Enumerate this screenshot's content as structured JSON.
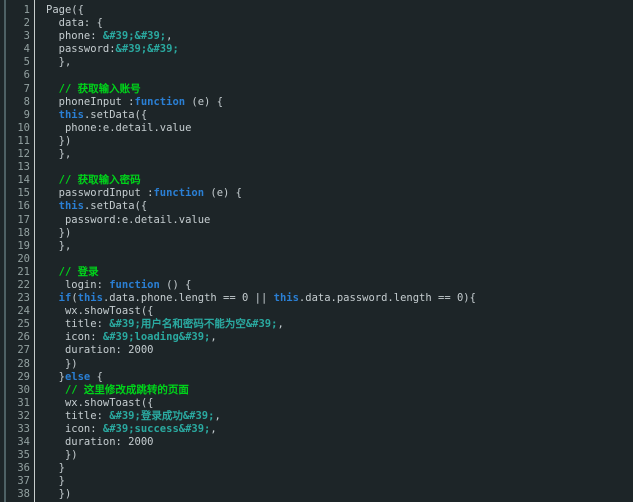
{
  "editor": {
    "theme_name": "dark-code-viewer",
    "background_color": "#1d2528",
    "gutter_text_color": "#93a1a1",
    "code_text_color": "#c5cdd0",
    "comment_color": "#00d21a",
    "keyword_color": "#2a7fd4",
    "string_color": "#2aa9a0",
    "separator_color": "#c7cdcd",
    "rail_color": "#4e6165",
    "first_line_number": 1,
    "last_line_number": 38,
    "total_lines": 38,
    "language": "javascript"
  },
  "lines": [
    {
      "num": "1",
      "tokens": [
        {
          "t": "Page({",
          "c": "plain"
        }
      ]
    },
    {
      "num": "2",
      "tokens": [
        {
          "t": "  data: {",
          "c": "plain"
        }
      ]
    },
    {
      "num": "3",
      "tokens": [
        {
          "t": "  phone: ",
          "c": "plain"
        },
        {
          "t": "&#39;&#39;",
          "c": "string"
        },
        {
          "t": ",",
          "c": "plain"
        }
      ]
    },
    {
      "num": "4",
      "tokens": [
        {
          "t": "  password:",
          "c": "plain"
        },
        {
          "t": "&#39;&#39;",
          "c": "string"
        }
      ]
    },
    {
      "num": "5",
      "tokens": [
        {
          "t": "  },",
          "c": "plain"
        }
      ]
    },
    {
      "num": "6",
      "tokens": [
        {
          "t": "",
          "c": "plain"
        }
      ]
    },
    {
      "num": "7",
      "tokens": [
        {
          "t": "  // 获取输入账号",
          "c": "comment"
        }
      ]
    },
    {
      "num": "8",
      "tokens": [
        {
          "t": "  phoneInput :",
          "c": "plain"
        },
        {
          "t": "function",
          "c": "keyword"
        },
        {
          "t": " (e) {",
          "c": "plain"
        }
      ]
    },
    {
      "num": "9",
      "tokens": [
        {
          "t": "  ",
          "c": "plain"
        },
        {
          "t": "this",
          "c": "keyword"
        },
        {
          "t": ".setData({",
          "c": "plain"
        }
      ]
    },
    {
      "num": "10",
      "tokens": [
        {
          "t": "   phone:e.detail.value",
          "c": "plain"
        }
      ]
    },
    {
      "num": "11",
      "tokens": [
        {
          "t": "  })",
          "c": "plain"
        }
      ]
    },
    {
      "num": "12",
      "tokens": [
        {
          "t": "  },",
          "c": "plain"
        }
      ]
    },
    {
      "num": "13",
      "tokens": [
        {
          "t": "",
          "c": "plain"
        }
      ]
    },
    {
      "num": "14",
      "tokens": [
        {
          "t": "  // 获取输入密码",
          "c": "comment"
        }
      ]
    },
    {
      "num": "15",
      "tokens": [
        {
          "t": "  passwordInput :",
          "c": "plain"
        },
        {
          "t": "function",
          "c": "keyword"
        },
        {
          "t": " (e) {",
          "c": "plain"
        }
      ]
    },
    {
      "num": "16",
      "tokens": [
        {
          "t": "  ",
          "c": "plain"
        },
        {
          "t": "this",
          "c": "keyword"
        },
        {
          "t": ".setData({",
          "c": "plain"
        }
      ]
    },
    {
      "num": "17",
      "tokens": [
        {
          "t": "   password:e.detail.value",
          "c": "plain"
        }
      ]
    },
    {
      "num": "18",
      "tokens": [
        {
          "t": "  })",
          "c": "plain"
        }
      ]
    },
    {
      "num": "19",
      "tokens": [
        {
          "t": "  },",
          "c": "plain"
        }
      ]
    },
    {
      "num": "20",
      "tokens": [
        {
          "t": "",
          "c": "plain"
        }
      ]
    },
    {
      "num": "21",
      "tokens": [
        {
          "t": "  // 登录",
          "c": "comment"
        }
      ]
    },
    {
      "num": "22",
      "tokens": [
        {
          "t": "   login: ",
          "c": "plain"
        },
        {
          "t": "function",
          "c": "keyword"
        },
        {
          "t": " () {",
          "c": "plain"
        }
      ]
    },
    {
      "num": "23",
      "tokens": [
        {
          "t": "  ",
          "c": "plain"
        },
        {
          "t": "if",
          "c": "keyword"
        },
        {
          "t": "(",
          "c": "plain"
        },
        {
          "t": "this",
          "c": "keyword"
        },
        {
          "t": ".data.phone.length == 0 || ",
          "c": "plain"
        },
        {
          "t": "this",
          "c": "keyword"
        },
        {
          "t": ".data.password.length == 0){",
          "c": "plain"
        }
      ]
    },
    {
      "num": "24",
      "tokens": [
        {
          "t": "   wx.showToast({",
          "c": "plain"
        }
      ]
    },
    {
      "num": "25",
      "tokens": [
        {
          "t": "   title: ",
          "c": "plain"
        },
        {
          "t": "&#39;用户名和密码不能为空&#39;",
          "c": "string"
        },
        {
          "t": ",",
          "c": "plain"
        }
      ]
    },
    {
      "num": "26",
      "tokens": [
        {
          "t": "   icon: ",
          "c": "plain"
        },
        {
          "t": "&#39;loading&#39;",
          "c": "string"
        },
        {
          "t": ",",
          "c": "plain"
        }
      ]
    },
    {
      "num": "27",
      "tokens": [
        {
          "t": "   duration: 2000",
          "c": "plain"
        }
      ]
    },
    {
      "num": "28",
      "tokens": [
        {
          "t": "   })",
          "c": "plain"
        }
      ]
    },
    {
      "num": "29",
      "tokens": [
        {
          "t": "  }",
          "c": "plain"
        },
        {
          "t": "else",
          "c": "keyword"
        },
        {
          "t": " {",
          "c": "plain"
        }
      ]
    },
    {
      "num": "30",
      "tokens": [
        {
          "t": "   // 这里修改成跳转的页面",
          "c": "comment"
        }
      ]
    },
    {
      "num": "31",
      "tokens": [
        {
          "t": "   wx.showToast({",
          "c": "plain"
        }
      ]
    },
    {
      "num": "32",
      "tokens": [
        {
          "t": "   title: ",
          "c": "plain"
        },
        {
          "t": "&#39;登录成功&#39;",
          "c": "string"
        },
        {
          "t": ",",
          "c": "plain"
        }
      ]
    },
    {
      "num": "33",
      "tokens": [
        {
          "t": "   icon: ",
          "c": "plain"
        },
        {
          "t": "&#39;success&#39;",
          "c": "string"
        },
        {
          "t": ",",
          "c": "plain"
        }
      ]
    },
    {
      "num": "34",
      "tokens": [
        {
          "t": "   duration: 2000",
          "c": "plain"
        }
      ]
    },
    {
      "num": "35",
      "tokens": [
        {
          "t": "   })",
          "c": "plain"
        }
      ]
    },
    {
      "num": "36",
      "tokens": [
        {
          "t": "  }",
          "c": "plain"
        }
      ]
    },
    {
      "num": "37",
      "tokens": [
        {
          "t": "  }",
          "c": "plain"
        }
      ]
    },
    {
      "num": "38",
      "tokens": [
        {
          "t": "  })",
          "c": "plain"
        }
      ]
    }
  ]
}
